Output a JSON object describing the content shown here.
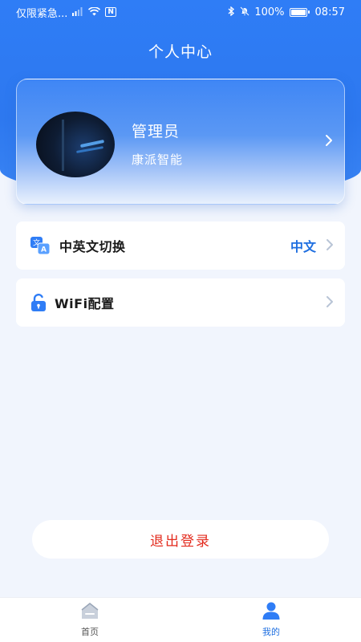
{
  "status_bar": {
    "carrier_text": "仅限紧急...",
    "battery_percent": "100%",
    "time": "08:57",
    "battery_level": 1.0,
    "icons": [
      "signal-icon",
      "wifi-icon",
      "nfc-icon",
      "bluetooth-icon",
      "mute-icon",
      "battery-icon"
    ]
  },
  "header": {
    "title": "个人中心"
  },
  "profile": {
    "name": "管理员",
    "company": "康派智能"
  },
  "settings": {
    "language": {
      "label": "中英文切换",
      "value": "中文",
      "icon": "translate-icon"
    },
    "wifi": {
      "label": "WiFi配置",
      "icon": "lock-icon"
    }
  },
  "logout_label": "退出登录",
  "tabbar": {
    "home_label": "首页",
    "mine_label": "我的",
    "active": "mine"
  },
  "colors": {
    "primary": "#2f7df6",
    "accent_text": "#1f6fe0",
    "logout_red": "#e32b1e",
    "background": "#f1f5fd"
  }
}
